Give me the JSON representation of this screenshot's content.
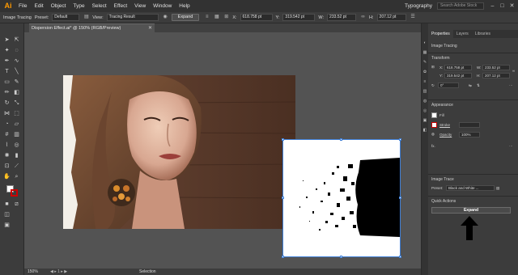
{
  "app": {
    "logo": "Ai"
  },
  "menu": [
    "File",
    "Edit",
    "Object",
    "Type",
    "Select",
    "Effect",
    "View",
    "Window",
    "Help"
  ],
  "workspace": "Typography",
  "search_placeholder": "Search Adobe Stock",
  "control_bar": {
    "mode_label": "Image Tracing",
    "preset_label": "Preset:",
    "preset_value": "Default",
    "view_label": "View:",
    "view_value": "Tracing Result",
    "expand_label": "Expand",
    "x_label": "X:",
    "x_value": "618.758 pt",
    "y_label": "Y:",
    "y_value": "319.542 pt",
    "w_label": "W:",
    "w_value": "233.52 pt",
    "h_label": "H:",
    "h_value": "207.12 pt"
  },
  "document_tab": {
    "title": "Dispersion Effect.ai* @ 150% (RGB/Preview)"
  },
  "status_bar": {
    "zoom": "150%",
    "mode": "Selection"
  },
  "properties": {
    "tabs": [
      "Properties",
      "Layers",
      "Libraries"
    ],
    "object_type": "Image Tracing",
    "transform_title": "Transform",
    "x_label": "X:",
    "x_value": "618.758 pt",
    "w_label": "W:",
    "w_value": "233.52 pt",
    "y_label": "Y:",
    "y_value": "319.542 pt",
    "h_label": "H:",
    "h_value": "207.12 pt",
    "rotation_value": "0°",
    "appearance_title": "Appearance",
    "fill_label": "Fill",
    "stroke_label": "Stroke",
    "opacity_label": "Opacity",
    "opacity_value": "100%",
    "fx_label": "fx.",
    "image_trace_title": "Image Trace",
    "preset_label": "Preset:",
    "preset_value": "Black and White ...",
    "quick_actions_title": "Quick Actions",
    "expand_label": "Expand"
  },
  "colors": {
    "accent": "#3f7fd6",
    "ai_orange": "#ff9a00",
    "arrow": "#000000"
  }
}
